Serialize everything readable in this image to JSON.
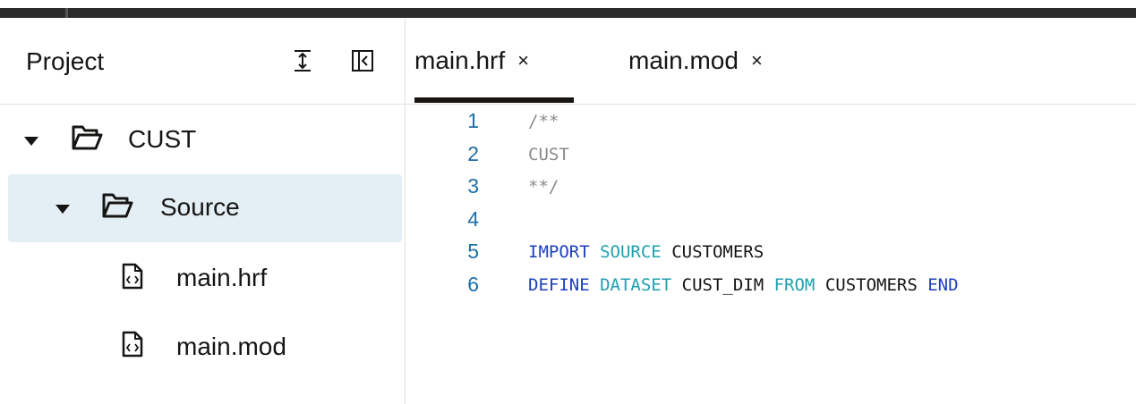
{
  "sidebar": {
    "title": "Project",
    "tree": [
      {
        "label": "CUST",
        "type": "folder",
        "expanded": true
      },
      {
        "label": "Source",
        "type": "folder",
        "expanded": true,
        "selected": true
      },
      {
        "label": "main.hrf",
        "type": "file"
      },
      {
        "label": "main.mod",
        "type": "file"
      }
    ]
  },
  "tabs": [
    {
      "label": "main.hrf",
      "close": "×",
      "active": true
    },
    {
      "label": "main.mod",
      "close": "×",
      "active": false
    }
  ],
  "code": {
    "lines": [
      {
        "num": "1",
        "tokens": [
          {
            "t": "/**",
            "c": "comment"
          }
        ]
      },
      {
        "num": "2",
        "tokens": [
          {
            "t": "CUST",
            "c": "comment"
          }
        ]
      },
      {
        "num": "3",
        "tokens": [
          {
            "t": "**/",
            "c": "comment"
          }
        ]
      },
      {
        "num": "4",
        "tokens": []
      },
      {
        "num": "5",
        "tokens": [
          {
            "t": "IMPORT",
            "c": "kw-blue"
          },
          {
            "t": " ",
            "c": "ident"
          },
          {
            "t": "SOURCE",
            "c": "kw-teal"
          },
          {
            "t": " ",
            "c": "ident"
          },
          {
            "t": "CUSTOMERS",
            "c": "ident"
          }
        ]
      },
      {
        "num": "6",
        "tokens": [
          {
            "t": "DEFINE",
            "c": "kw-blue"
          },
          {
            "t": " ",
            "c": "ident"
          },
          {
            "t": "DATASET",
            "c": "kw-teal"
          },
          {
            "t": " ",
            "c": "ident"
          },
          {
            "t": "CUST_DIM",
            "c": "ident"
          },
          {
            "t": " ",
            "c": "ident"
          },
          {
            "t": "FROM",
            "c": "kw-teal"
          },
          {
            "t": " ",
            "c": "ident"
          },
          {
            "t": "CUSTOMERS",
            "c": "ident"
          },
          {
            "t": " ",
            "c": "ident"
          },
          {
            "t": "END",
            "c": "kw-blue"
          }
        ]
      }
    ]
  },
  "colors": {
    "selected_row": "#e4eff5",
    "line_number": "#1b6fa8",
    "keyword_blue": "#1b3fbf",
    "keyword_teal": "#1fa0b0",
    "comment": "#8a8a8a"
  },
  "icons": {
    "expand_all": "expand-all-icon",
    "collapse_panel": "collapse-panel-icon",
    "folder": "folder-open-icon",
    "file": "code-file-icon",
    "caret": "caret-down-icon"
  }
}
